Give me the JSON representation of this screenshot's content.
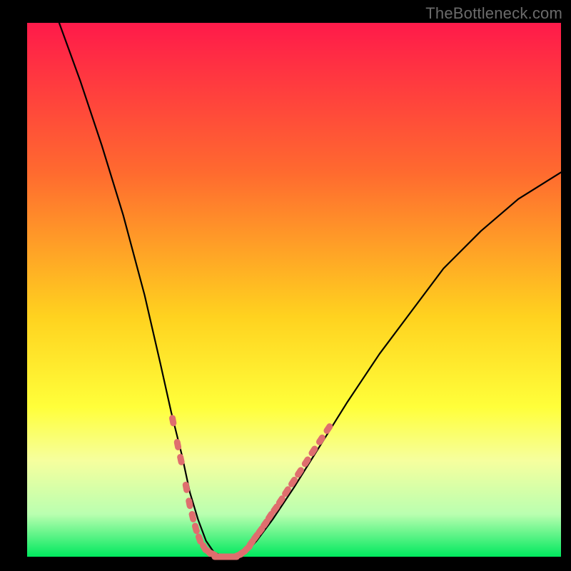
{
  "watermark": "TheBottleneck.com",
  "colors": {
    "black": "#000000",
    "curve": "#000000",
    "marker": "#df6e6e",
    "grad_top": "#ff1a4a",
    "grad_mid1": "#ff6a2f",
    "grad_mid2": "#ffd21f",
    "grad_mid3": "#ffff3a",
    "grad_low1": "#f6ff9e",
    "grad_low2": "#baffb0",
    "grad_bottom": "#00e85e"
  },
  "chart_data": {
    "type": "line",
    "title": "",
    "xlabel": "",
    "ylabel": "",
    "xlim": [
      0,
      100
    ],
    "ylim": [
      0,
      100
    ],
    "grid": false,
    "legend": false,
    "series": [
      {
        "name": "bottleneck-curve",
        "x": [
          6,
          10,
          14,
          18,
          22,
          25,
          27,
          29,
          30.5,
          32,
          33.5,
          35,
          37,
          39,
          41,
          43,
          46,
          50,
          55,
          60,
          66,
          72,
          78,
          85,
          92,
          100
        ],
        "y": [
          100,
          89,
          77,
          64,
          49,
          36,
          27,
          19,
          12,
          7,
          3,
          0.8,
          0,
          0,
          0.8,
          3,
          7,
          13,
          21,
          29,
          38,
          46,
          54,
          61,
          67,
          72
        ]
      }
    ],
    "highlighted_segments": [
      {
        "name": "left-markers",
        "x": [
          27.3,
          28.2,
          28.8,
          29.8,
          30.4,
          31.0,
          31.6,
          32.3,
          33.2,
          34.0,
          34.8
        ],
        "y": [
          25.5,
          21.0,
          18.2,
          13.0,
          10.0,
          7.5,
          5.3,
          3.3,
          1.7,
          0.9,
          0.5
        ]
      },
      {
        "name": "bottom-markers",
        "x": [
          35.6,
          36.4,
          37.2,
          38.0,
          38.8,
          39.6,
          40.4,
          41.3
        ],
        "y": [
          0.0,
          0.0,
          0.0,
          0.0,
          0.0,
          0.3,
          0.8,
          1.6
        ]
      },
      {
        "name": "right-markers",
        "x": [
          42.0,
          42.8,
          43.7,
          44.6,
          45.5,
          46.5,
          47.5,
          48.6,
          49.8,
          51.0,
          52.3,
          53.6,
          55.0,
          56.4
        ],
        "y": [
          2.6,
          3.7,
          4.9,
          6.2,
          7.6,
          9.0,
          10.5,
          12.2,
          14.0,
          15.8,
          17.8,
          19.8,
          21.9,
          24.0
        ]
      }
    ]
  }
}
